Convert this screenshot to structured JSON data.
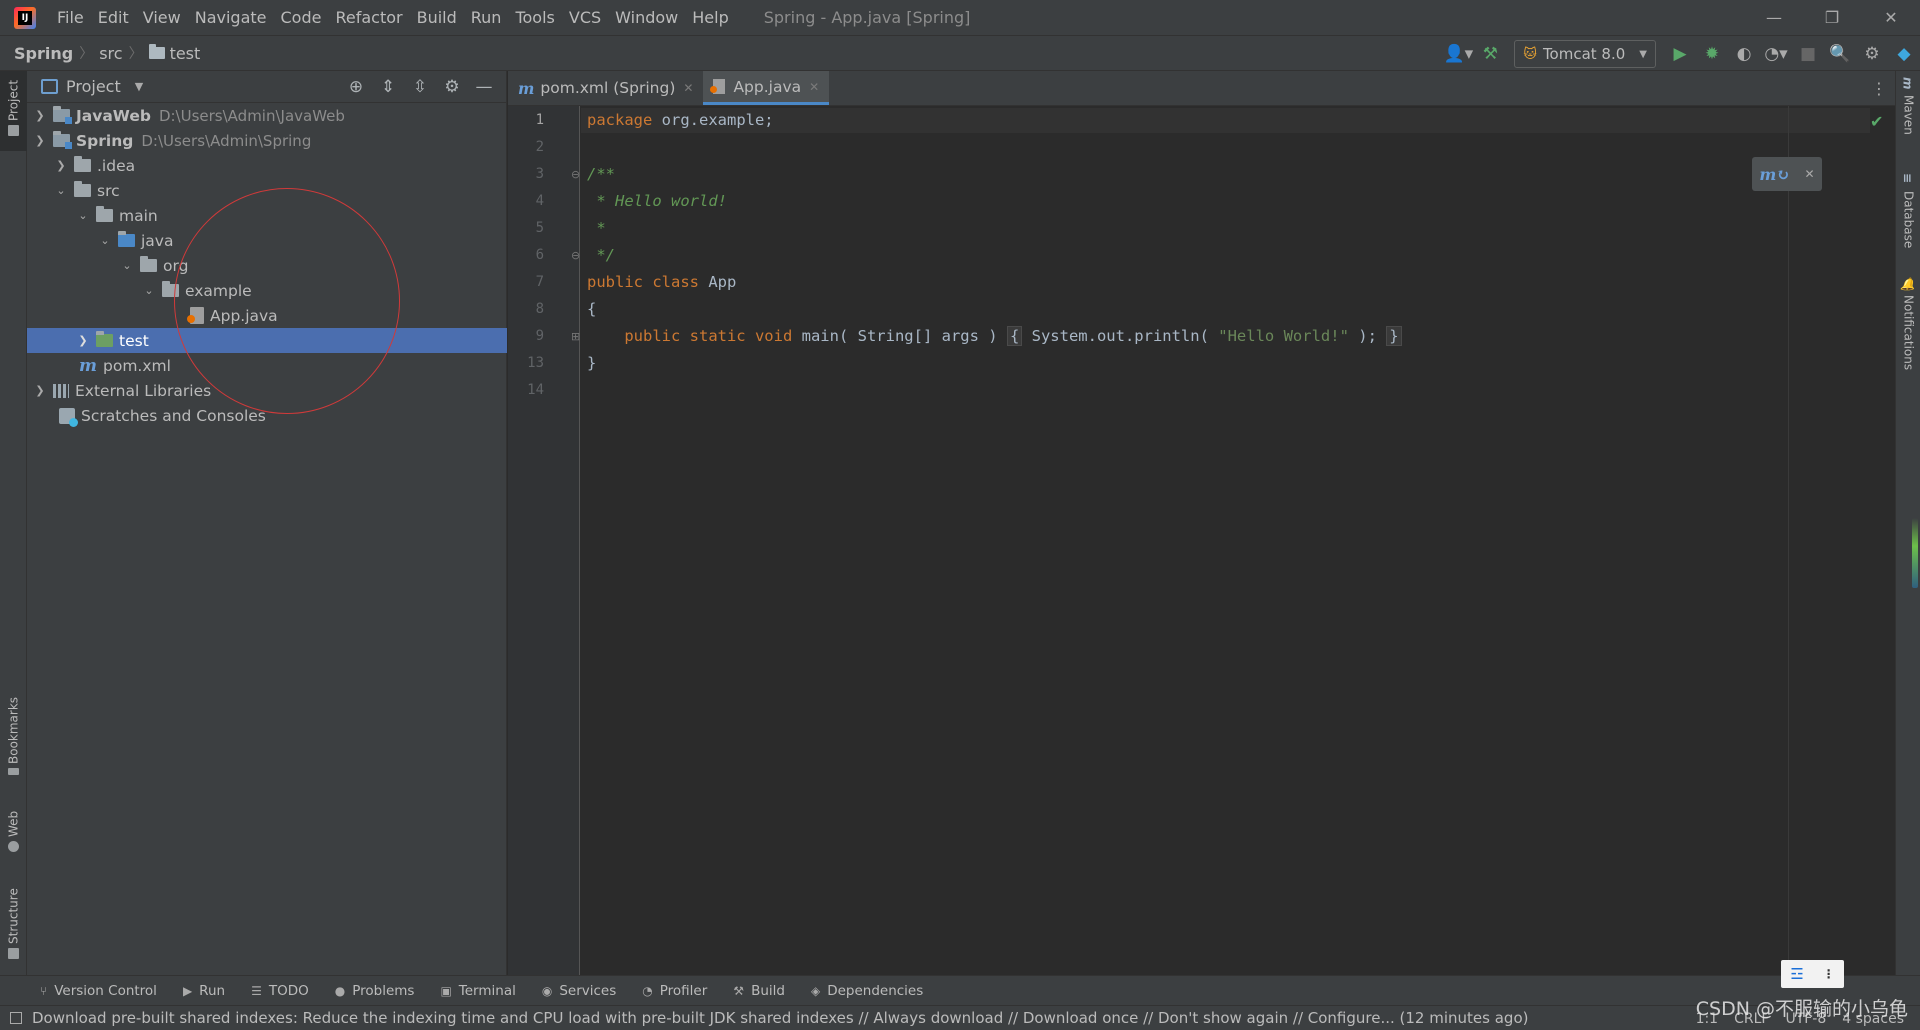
{
  "menubar": {
    "items": [
      "File",
      "Edit",
      "View",
      "Navigate",
      "Code",
      "Refactor",
      "Build",
      "Run",
      "Tools",
      "VCS",
      "Window",
      "Help"
    ],
    "window_title": "Spring - App.java [Spring]",
    "controls": {
      "minimize": "—",
      "restore": "❐",
      "close": "✕"
    }
  },
  "navbar": {
    "breadcrumbs": [
      "Spring",
      "src",
      "test"
    ],
    "run_config": "Tomcat 8.0"
  },
  "left_stripe": {
    "project": "Project",
    "bookmarks": "Bookmarks",
    "web": "Web",
    "structure": "Structure"
  },
  "right_stripe": {
    "maven": "Maven",
    "database": "Database",
    "notifications": "Notifications"
  },
  "project_panel": {
    "title": "Project",
    "tree": [
      {
        "label": "JavaWeb",
        "hint": "D:\\Users\\Admin\\JavaWeb",
        "type": "module",
        "expanded": false,
        "depth": 0
      },
      {
        "label": "Spring",
        "hint": "D:\\Users\\Admin\\Spring",
        "type": "module",
        "expanded": true,
        "depth": 0
      },
      {
        "label": ".idea",
        "type": "folder",
        "expanded": false,
        "depth": 1
      },
      {
        "label": "src",
        "type": "folder",
        "expanded": true,
        "depth": 1
      },
      {
        "label": "main",
        "type": "folder",
        "expanded": true,
        "depth": 2
      },
      {
        "label": "java",
        "type": "folder",
        "expanded": true,
        "depth": 3
      },
      {
        "label": "org",
        "type": "folder",
        "expanded": true,
        "depth": 4
      },
      {
        "label": "example",
        "type": "folder",
        "expanded": true,
        "depth": 5
      },
      {
        "label": "App.java",
        "type": "java",
        "depth": 6
      },
      {
        "label": "test",
        "type": "folder",
        "expanded": false,
        "depth": 2,
        "selected": true
      },
      {
        "label": "pom.xml",
        "type": "maven",
        "depth": 1
      },
      {
        "label": "External Libraries",
        "type": "libs",
        "expanded": false,
        "depth": 0
      },
      {
        "label": "Scratches and Consoles",
        "type": "scratch",
        "depth": 0
      }
    ]
  },
  "editor": {
    "tabs": [
      {
        "label": "pom.xml (Spring)",
        "active": false
      },
      {
        "label": "App.java",
        "active": true
      }
    ],
    "line_numbers": [
      "1",
      "2",
      "3",
      "4",
      "5",
      "6",
      "7",
      "8",
      "9",
      "13",
      "14"
    ],
    "code": {
      "l1_kw": "package",
      "l1_rest": " org.example;",
      "l3": "/**",
      "l4": " * Hello world!",
      "l5": " *",
      "l6": " */",
      "l7_kw": "public class",
      "l7_rest": " App",
      "l8": "{",
      "l9_indent": "    ",
      "l9_kw": "public static void",
      "l9_rest": " main( String[] args ) ",
      "l9_open": "{",
      "l9_body": " System.out.println( ",
      "l9_str": "\"Hello World!\"",
      "l9_end": " ); ",
      "l9_close": "}",
      "l13": "}"
    }
  },
  "bottom_tools": [
    "Version Control",
    "Run",
    "TODO",
    "Problems",
    "Terminal",
    "Services",
    "Profiler",
    "Build",
    "Dependencies"
  ],
  "status": {
    "message": "Download pre-built shared indexes: Reduce the indexing time and CPU load with pre-built JDK shared indexes // Always download // Download once // Don't show again // Configure... (12 minutes ago)",
    "position": "1:1",
    "line_sep": "CRLF",
    "encoding": "UTF-8",
    "indent": "4 spaces"
  },
  "watermark": "CSDN @不服输的小乌龟"
}
